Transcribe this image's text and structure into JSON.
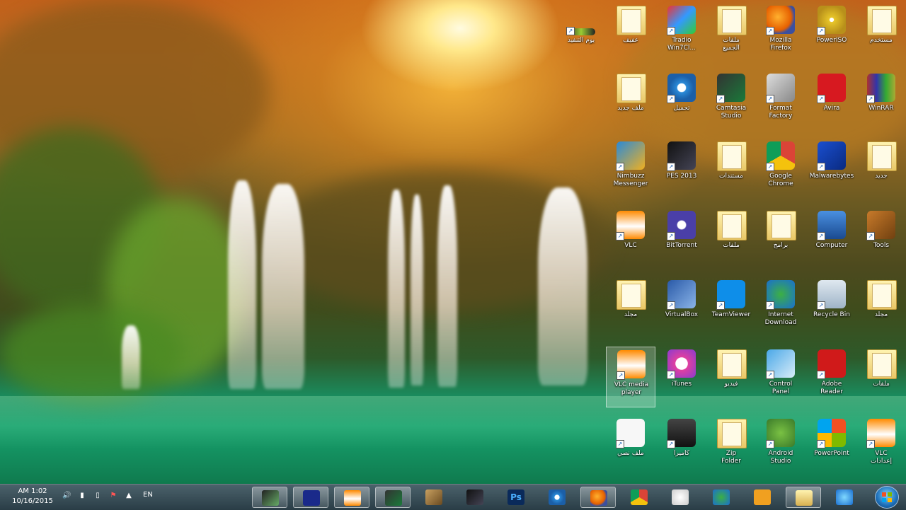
{
  "colors": {
    "taskbar": "#2f4a55",
    "lake": "#18a36f",
    "sun": "#ffe88a"
  },
  "taskbar": {
    "clock_time": "AM 1:02",
    "clock_date": "10/16/2015",
    "language": "EN",
    "pinned": [
      {
        "name": "app-green",
        "icon": "green-app-icon"
      },
      {
        "name": "zip-app",
        "icon": "z-app-icon"
      },
      {
        "name": "vlc",
        "icon": "vlc-cone-icon"
      },
      {
        "name": "camtasia",
        "icon": "camtasia-icon"
      },
      {
        "name": "pen-tool",
        "icon": "pen-icon"
      },
      {
        "name": "pes",
        "icon": "pes-game-icon"
      },
      {
        "name": "photoshop",
        "icon": "photoshop-icon",
        "text": "Ps"
      },
      {
        "name": "browser-eye",
        "icon": "eye-browser-icon"
      },
      {
        "name": "firefox",
        "icon": "firefox-icon"
      },
      {
        "name": "chrome",
        "icon": "chrome-icon"
      },
      {
        "name": "badminton",
        "icon": "shuttlecock-icon"
      },
      {
        "name": "internet-download",
        "icon": "idm-globe-icon"
      },
      {
        "name": "media-player",
        "icon": "media-play-icon"
      },
      {
        "name": "explorer",
        "icon": "folder-explorer-icon"
      },
      {
        "name": "internet-explorer",
        "icon": "ie-icon"
      }
    ]
  },
  "desktop": {
    "icons": [
      {
        "label": "يوم التنفيذ",
        "icon": "green-bar-icon"
      },
      {
        "label": "عفيف",
        "icon": "folder-icon"
      },
      {
        "label": "Tradio",
        "label2": "Win7Cl...",
        "icon": "grid-app-icon"
      },
      {
        "label": "ملفات",
        "label2": "الجميع",
        "icon": "folder-icon"
      },
      {
        "label": "Mozilla",
        "label2": "Firefox",
        "icon": "firefox-icon"
      },
      {
        "label": "PowerISO",
        "icon": "disc-icon"
      },
      {
        "label": "مستخدم",
        "icon": "user-folder-icon"
      },
      {
        "label": "ملف جديد",
        "icon": "folder-icon"
      },
      {
        "label": "تحميل",
        "icon": "eye-browser-icon"
      },
      {
        "label": "Camtasia",
        "label2": "Studio",
        "icon": "camtasia-icon"
      },
      {
        "label": "Format",
        "label2": "Factory",
        "icon": "format-factory-icon"
      },
      {
        "label": "Avira",
        "icon": "avira-icon"
      },
      {
        "label": "WinRAR",
        "icon": "winrar-icon"
      },
      {
        "label": "Nimbuzz",
        "label2": "Messenger",
        "icon": "messenger-icon"
      },
      {
        "label": "PES 2013",
        "icon": "pes-game-icon"
      },
      {
        "label": "مستندات",
        "icon": "document-folder-icon"
      },
      {
        "label": "Google",
        "label2": "Chrome",
        "icon": "chrome-icon"
      },
      {
        "label": "Malwarebytes",
        "icon": "malwarebytes-icon"
      },
      {
        "label": "جديد",
        "icon": "folder-icon"
      },
      {
        "label": "VLC",
        "icon": "vlc-cone-icon"
      },
      {
        "label": "BitTorrent",
        "icon": "bittorrent-icon"
      },
      {
        "label": "ملفات",
        "icon": "folder-icon"
      },
      {
        "label": "برامج",
        "icon": "folder-icon"
      },
      {
        "label": "Computer",
        "icon": "computer-icon"
      },
      {
        "label": "Tools",
        "icon": "tools-icon"
      },
      {
        "label": "مجلد",
        "icon": "folder-icon"
      },
      {
        "label": "VirtualBox",
        "icon": "virtualbox-icon"
      },
      {
        "label": "TeamViewer",
        "icon": "teamviewer-icon"
      },
      {
        "label": "Internet",
        "label2": "Download",
        "icon": "idm-globe-icon"
      },
      {
        "label": "Recycle Bin",
        "icon": "recycle-bin-icon"
      },
      {
        "label": "مجلد",
        "icon": "folder-icon"
      },
      {
        "label": "VLC media",
        "label2": "player",
        "icon": "vlc-cone-icon",
        "selected": true
      },
      {
        "label": "iTunes",
        "icon": "itunes-icon"
      },
      {
        "label": "فيديو",
        "icon": "folder-icon"
      },
      {
        "label": "Control",
        "label2": "Panel",
        "icon": "control-panel-icon"
      },
      {
        "label": "Adobe",
        "label2": "Reader",
        "icon": "acrobat-icon"
      },
      {
        "label": "ملفات",
        "icon": "cabinet-folder-icon"
      },
      {
        "label": "ملف نصي",
        "icon": "text-file-icon"
      },
      {
        "label": "كاميرا",
        "icon": "camera-app-icon"
      },
      {
        "label": "Zip",
        "label2": "Folder",
        "icon": "zip-folder-icon"
      },
      {
        "label": "Android",
        "label2": "Studio",
        "icon": "android-studio-icon"
      },
      {
        "label": "PowerPoint",
        "icon": "windows-logo-icon"
      },
      {
        "label": "VLC",
        "label2": "إعدادات",
        "icon": "vlc-cone-icon"
      }
    ]
  }
}
